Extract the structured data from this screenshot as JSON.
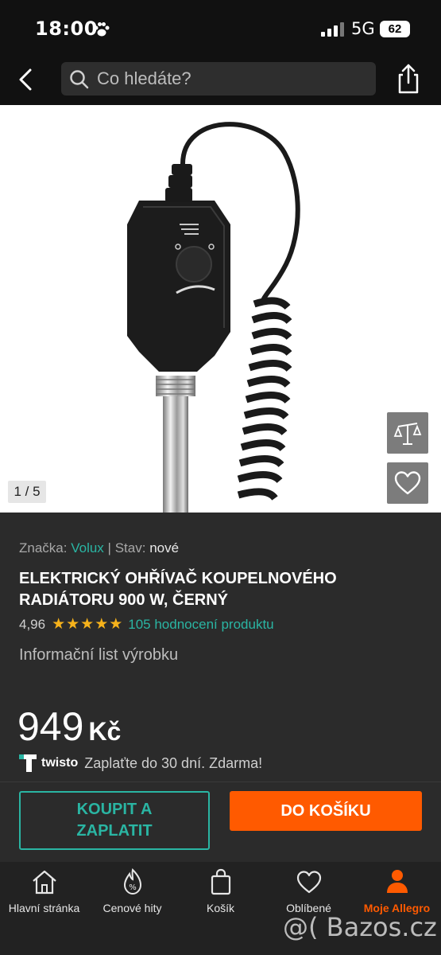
{
  "status": {
    "time": "18:00",
    "network": "5G",
    "battery": "62"
  },
  "search": {
    "placeholder": "Co hledáte?"
  },
  "gallery": {
    "counter": "1 / 5"
  },
  "product": {
    "brand_label": "Značka:",
    "brand": "Volux",
    "separator": "|",
    "condition_label": "Stav:",
    "condition": "nové",
    "title": "ELEKTRICKÝ OHŘÍVAČ KOUPELNOVÉHO RADIÁTORU 900 W, ČERNÝ",
    "rating": "4,96",
    "stars": 5,
    "reviews": "105 hodnocení produktu",
    "info_sheet": "Informační list výrobku",
    "price": "949",
    "currency": "Kč"
  },
  "twisto": {
    "name": "twisto",
    "text": "Zaplaťte do 30 dní. Zdarma!"
  },
  "actions": {
    "buy_now": "KOUPIT A ZAPLATIT",
    "add_to_cart": "DO KOŠÍKU"
  },
  "tabs": [
    {
      "label": "Hlavní stránka",
      "icon": "home-icon"
    },
    {
      "label": "Cenové hity",
      "icon": "price-tag-icon"
    },
    {
      "label": "Košík",
      "icon": "bag-icon"
    },
    {
      "label": "Oblíbené",
      "icon": "heart-icon"
    },
    {
      "label": "Moje Allegro",
      "icon": "user-icon"
    }
  ],
  "watermark": "@( Bazos.cz",
  "colors": {
    "accent": "#2ab5a3",
    "brand": "#ff5a00",
    "background": "#2b2b2b",
    "stars": "#f6b21b"
  }
}
